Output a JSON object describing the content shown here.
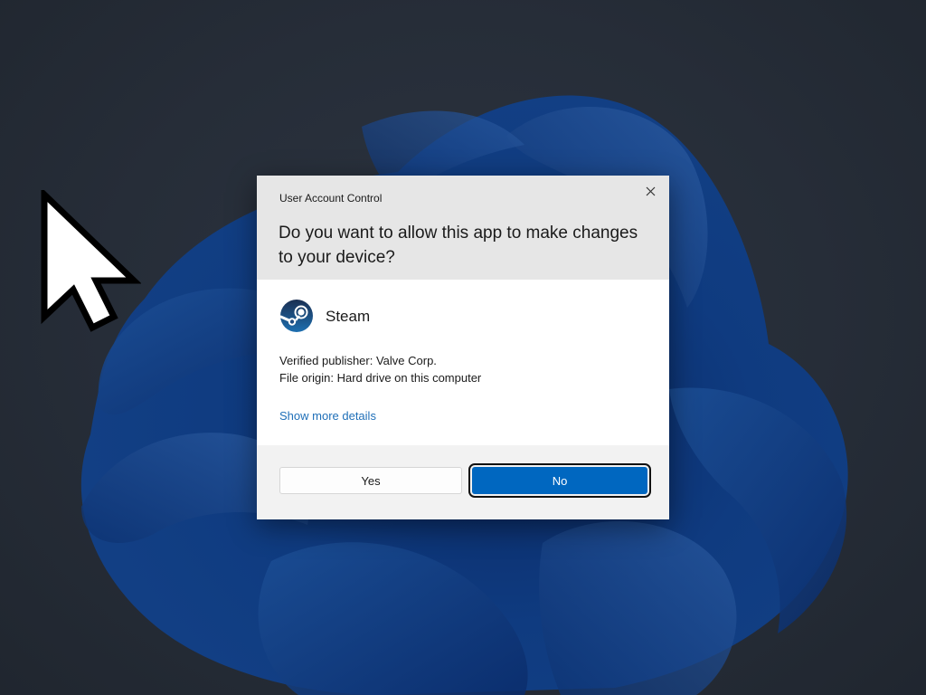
{
  "dialog": {
    "window_title": "User Account Control",
    "question": "Do you want to allow this app to make changes to your device?",
    "app_name": "Steam",
    "app_icon": "steam-logo-icon",
    "publisher_line": "Verified publisher: Valve Corp.",
    "origin_line": "File origin: Hard drive on this computer",
    "details_link": "Show more details",
    "yes_label": "Yes",
    "no_label": "No",
    "close_icon": "close-icon"
  },
  "colors": {
    "header_bg": "#e6e6e6",
    "footer_bg": "#f2f2f2",
    "link": "#1f6fb8",
    "primary_button": "#0067c0",
    "desktop_bg": "#262d38",
    "bloom": "#0e3a7a"
  }
}
